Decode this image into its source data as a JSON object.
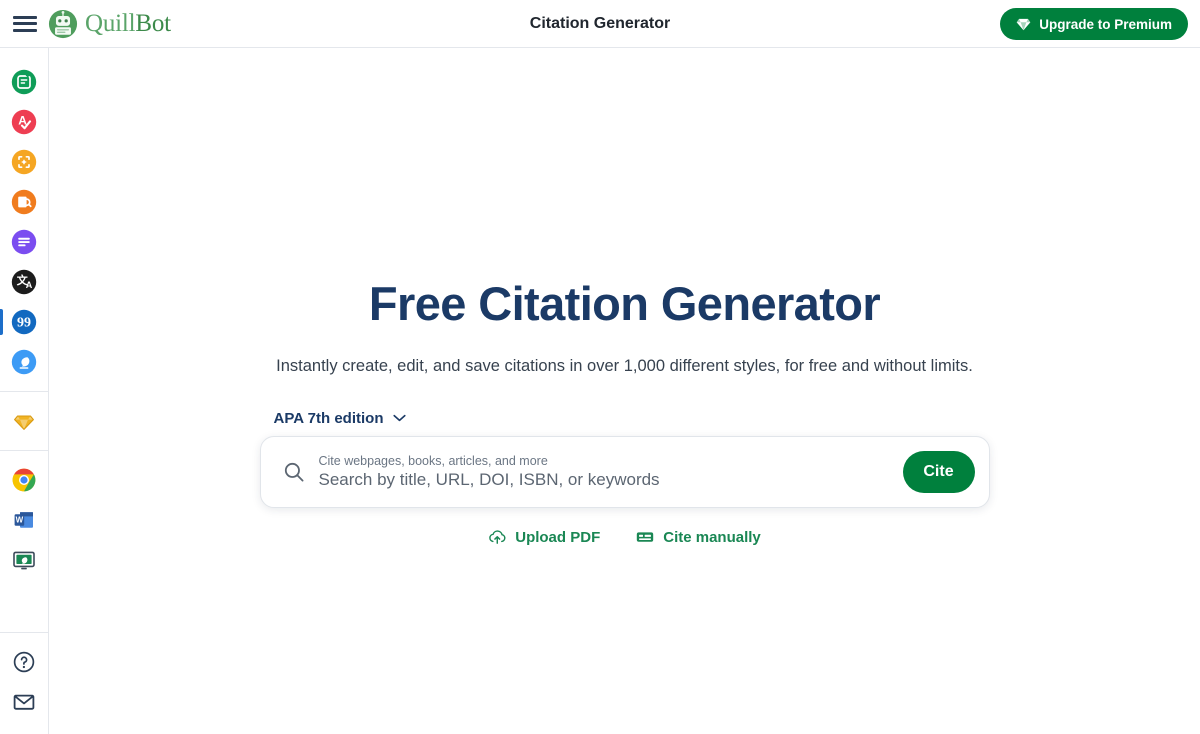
{
  "topbar": {
    "menu_icon": "hamburger-menu-icon",
    "brand_part1": "Quill",
    "brand_part2": "Bot",
    "brand_logo_icon": "quillbot-robot-logo",
    "title": "Citation Generator",
    "upgrade_label": "Upgrade to Premium",
    "upgrade_icon": "diamond-icon",
    "upgrade_bg": "#00803d"
  },
  "sidebar": {
    "active_indicator_color": "#1d6ec9",
    "groups": [
      {
        "items": [
          {
            "name": "paraphraser",
            "label": "Paraphraser",
            "icon": "paraphraser-icon",
            "color": "#0f9d58",
            "active": false
          },
          {
            "name": "grammar-checker",
            "label": "Grammar Checker",
            "icon": "grammar-checker-icon",
            "color": "#ee3e52",
            "active": false
          },
          {
            "name": "ai-detector",
            "label": "AI Detector",
            "icon": "ai-detector-icon",
            "color": "#f5a623",
            "active": false
          },
          {
            "name": "plagiarism-checker",
            "label": "Plagiarism Checker",
            "icon": "plagiarism-checker-icon",
            "color": "#f07c1e",
            "active": false
          },
          {
            "name": "summarizer",
            "label": "Summarizer",
            "icon": "summarizer-icon",
            "color": "#7b4df0",
            "active": false
          },
          {
            "name": "translator",
            "label": "Translator",
            "icon": "translator-icon",
            "color": "#1c1c1c",
            "active": false
          },
          {
            "name": "citation-generator",
            "label": "Citation Generator",
            "icon": "quote-marks-icon",
            "color": "#1269c0",
            "active": true
          },
          {
            "name": "co-writer",
            "label": "Co-Writer",
            "icon": "quill-pen-icon",
            "color": "#3d9bf5",
            "active": false
          }
        ]
      },
      {
        "items": [
          {
            "name": "premium",
            "label": "Premium",
            "icon": "diamond-icon",
            "color": "#e8a317",
            "active": false
          }
        ]
      },
      {
        "items": [
          {
            "name": "chrome-extension",
            "label": "Chrome Extension",
            "icon": "chrome-icon",
            "color": "#4285f4",
            "active": false
          },
          {
            "name": "word-addin",
            "label": "Word Add-in",
            "icon": "word-icon",
            "color": "#2b579a",
            "active": false
          },
          {
            "name": "desktop-app",
            "label": "Desktop App",
            "icon": "monitor-icon",
            "color": "#1a8754",
            "active": false
          }
        ]
      }
    ],
    "bottom_items": [
      {
        "name": "help",
        "label": "Help",
        "icon": "question-circle-icon",
        "color": "#2c3e55"
      },
      {
        "name": "contact",
        "label": "Contact",
        "icon": "mail-icon",
        "color": "#2c3e55"
      }
    ]
  },
  "hero": {
    "title": "Free Citation Generator",
    "subtitle": "Instantly create, edit, and save citations in over 1,000 different styles, for free and without limits.",
    "title_color": "#1b3a66"
  },
  "citation": {
    "style_selected": "APA 7th edition",
    "style_chevron_icon": "chevron-down-icon",
    "search_icon": "search-icon",
    "search_label": "Cite webpages, books, articles, and more",
    "search_placeholder": "Search by title, URL, DOI, ISBN, or keywords",
    "search_value": "",
    "cite_button_label": "Cite",
    "cite_button_bg": "#00803d",
    "alt_actions": [
      {
        "name": "upload-pdf",
        "label": "Upload PDF",
        "icon": "cloud-upload-icon"
      },
      {
        "name": "cite-manually",
        "label": "Cite manually",
        "icon": "manual-entry-icon"
      }
    ],
    "alt_action_color": "#1a8754"
  }
}
